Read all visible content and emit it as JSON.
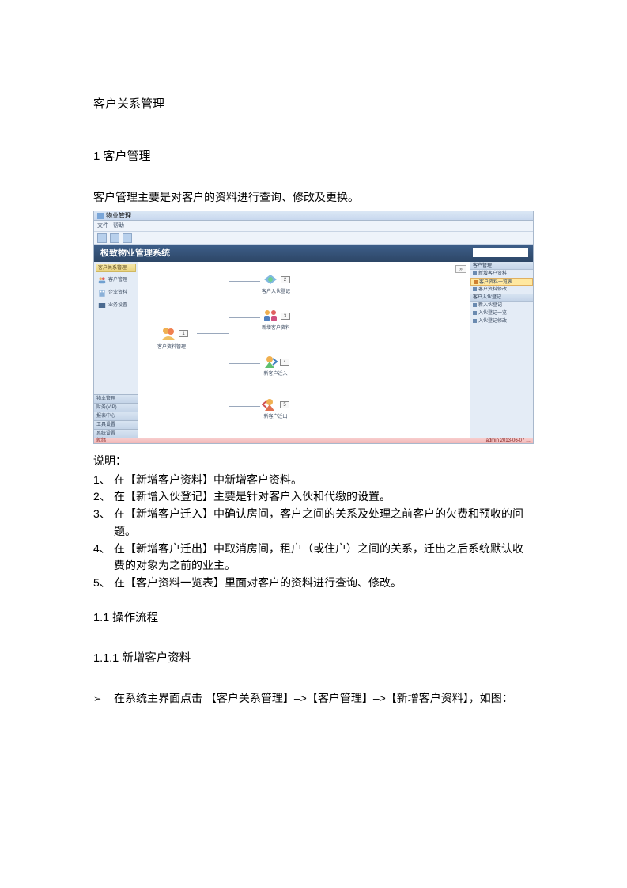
{
  "title": "客户关系管理",
  "section1": {
    "heading": "1 客户管理",
    "intro": "客户管理主要是对客户的资料进行查询、修改及更换。"
  },
  "screenshot": {
    "window_title": "物业管理",
    "menubar": [
      "文件",
      "帮助"
    ],
    "banner": "极致物业管理系统",
    "left_panel_header": "客户关系管理",
    "left_items": [
      {
        "label": "客户管理"
      },
      {
        "label": "企业资料"
      },
      {
        "label": "业务设置"
      }
    ],
    "left_nav": [
      "物业管理",
      "财务(VIP)",
      "报表中心",
      "工具设置",
      "系统设置"
    ],
    "diagram": {
      "root": {
        "label": "客户资料管理",
        "badge": "1"
      },
      "children": [
        {
          "label": "客户入伙登记",
          "badge": "2"
        },
        {
          "label": "新增客户资料",
          "badge": "3"
        },
        {
          "label": "新客户迁入",
          "badge": "4"
        },
        {
          "label": "新客户迁出",
          "badge": "5"
        }
      ]
    },
    "right_groups": [
      {
        "header": "客户管理",
        "items": [
          "新增客户资料",
          "客户资料一览表",
          "客户资料修改"
        ],
        "highlight_index": 1
      },
      {
        "header": "客户入伙登记",
        "items": [
          "新入伙登记",
          "入伙登记一览",
          "入伙登记修改"
        ]
      }
    ],
    "expand_btn": "»",
    "status_left": "就绪",
    "status_right": "admin  2013-06-07 …"
  },
  "desc_label": "说明：",
  "desc_items": [
    "在【新增客户资料】中新增客户资料。",
    "在【新增入伙登记】主要是针对客户入伙和代缴的设置。",
    "在【新增客户迁入】中确认房间，客户之间的关系及处理之前客户的欠费和预收的问题。",
    "在【新增客户迁出】中取消房间，租户（或住户）之间的关系，迁出之后系统默认收费的对象为之前的业主。",
    "在【客户资料一览表】里面对客户的资料进行查询、修改。"
  ],
  "section1_1": "1.1 操作流程",
  "section1_1_1": "1.1.1 新增客户资料",
  "step1": "在系统主界面点击 【客户关系管理】–>【客户管理】–>【新增客户资料】，如图："
}
